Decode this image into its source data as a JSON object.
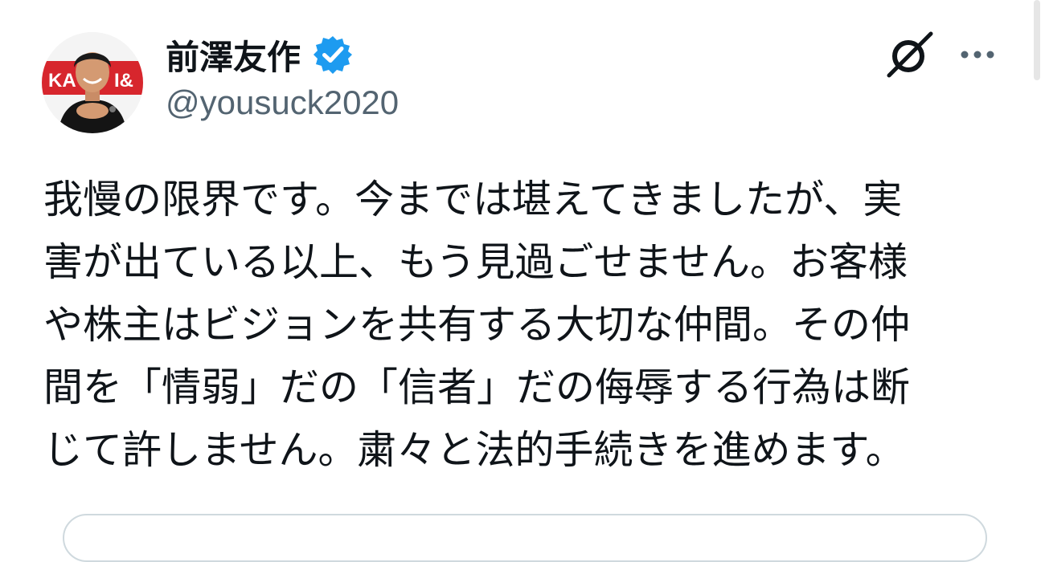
{
  "author": {
    "display_name": "前澤友作",
    "handle": "@yousuck2020",
    "avatar_banner_text": "KA",
    "avatar_banner_text_right": "I&",
    "verified": true
  },
  "icons": {
    "verified": "verified-badge-icon",
    "grok": "grok-icon",
    "more": "more-icon"
  },
  "colors": {
    "verified_blue": "#1d9bf0",
    "handle_gray": "#536471",
    "text_black": "#0f1419",
    "avatar_banner_red": "#d7262d"
  },
  "tweet": {
    "lines": [
      "我慢の限界です。今までは堪えてきましたが、実",
      "害が出ている以上、もう見過ごせません。お客様",
      "や株主はビジョンを共有する大切な仲間。その仲",
      "間を「情弱」だの「信者」だの侮辱する行為は断",
      "じて許しません。粛々と法的手続きを進めます。"
    ]
  }
}
